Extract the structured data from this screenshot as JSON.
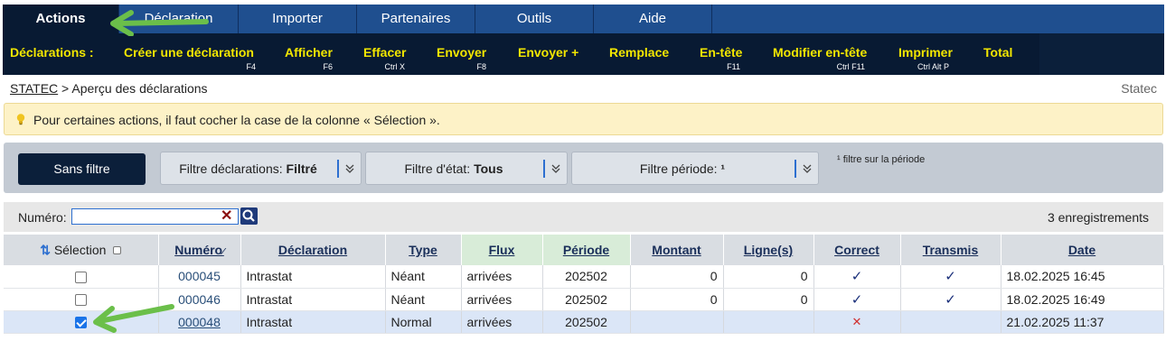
{
  "nav": {
    "tabs": [
      {
        "label": "Actions"
      },
      {
        "label": "Déclaration"
      },
      {
        "label": "Importer"
      },
      {
        "label": "Partenaires"
      },
      {
        "label": "Outils"
      },
      {
        "label": "Aide"
      }
    ]
  },
  "actions": {
    "title": "Déclarations :",
    "items": [
      {
        "label": "Créer une déclaration",
        "shortcut": "F4"
      },
      {
        "label": "Afficher",
        "shortcut": "F6"
      },
      {
        "label": "Effacer",
        "shortcut": "Ctrl X"
      },
      {
        "label": "Envoyer",
        "shortcut": "F8"
      },
      {
        "label": "Envoyer +",
        "shortcut": ""
      },
      {
        "label": "Remplace",
        "shortcut": ""
      },
      {
        "label": "En-tête",
        "shortcut": "F11"
      },
      {
        "label": "Modifier en-tête",
        "shortcut": "Ctrl F11"
      },
      {
        "label": "Imprimer",
        "shortcut": "Ctrl Alt P"
      },
      {
        "label": "Total",
        "shortcut": ""
      }
    ]
  },
  "breadcrumb": {
    "home": "STATEC",
    "separator": ">",
    "current": "Aperçu des déclarations",
    "site_label": "Statec"
  },
  "notice": {
    "icon": "lightbulb-icon",
    "text": "Pour certaines actions, il faut cocher la case de la colonne « Sélection »."
  },
  "filters": {
    "clear_button": "Sans filtre",
    "declarations": {
      "label": "Filtre déclarations:",
      "value": "Filtré"
    },
    "state": {
      "label": "Filtre d'état:",
      "value": "Tous"
    },
    "period": {
      "label": "Filtre période:",
      "value": "¹"
    },
    "note": "¹ filtre sur la période"
  },
  "search": {
    "label": "Numéro:",
    "value": "",
    "count": "3 enregistrements"
  },
  "table": {
    "headers": {
      "selection": "Sélection",
      "numero": "Numéro",
      "declaration": "Déclaration",
      "type": "Type",
      "flux": "Flux",
      "periode": "Période",
      "montant": "Montant",
      "lignes": "Ligne(s)",
      "correct": "Correct",
      "transmis": "Transmis",
      "date": "Date"
    },
    "rows": [
      {
        "checked": false,
        "numero": "000045",
        "declaration": "Intrastat",
        "type": "Néant",
        "flux": "arrivées",
        "periode": "202502",
        "montant": "0",
        "lignes": "0",
        "correct": "✓",
        "transmis": "✓",
        "date": "18.02.2025 16:45"
      },
      {
        "checked": false,
        "numero": "000046",
        "declaration": "Intrastat",
        "type": "Néant",
        "flux": "arrivées",
        "periode": "202502",
        "montant": "0",
        "lignes": "0",
        "correct": "✓",
        "transmis": "✓",
        "date": "18.02.2025 16:49"
      },
      {
        "checked": true,
        "numero": "000048",
        "declaration": "Intrastat",
        "type": "Normal",
        "flux": "arrivées",
        "periode": "202502",
        "montant": "",
        "lignes": "",
        "correct": "✕",
        "transmis": "",
        "date": "21.02.2025 11:37"
      }
    ]
  },
  "colors": {
    "nav_bg": "#1f4f8f",
    "action_bg": "#081a33",
    "action_text": "#f2e600",
    "notice_bg": "#fdf2c7",
    "annotation_arrow": "#6bbf4a"
  }
}
